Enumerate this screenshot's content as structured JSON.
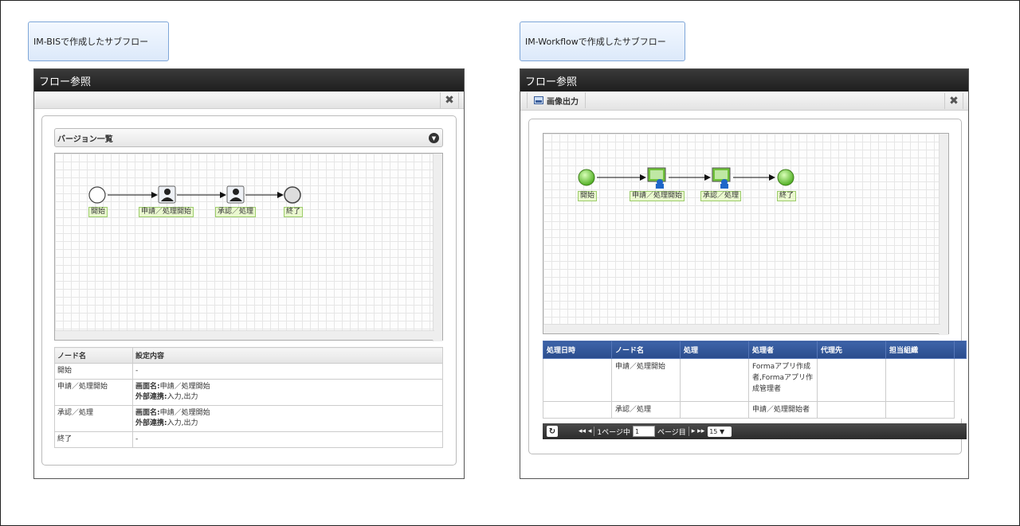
{
  "left": {
    "caption": "IM-BISで作成したサブフロー",
    "window_title": "フロー参照",
    "close_icon": "✖",
    "version_bar": "バージョン一覧",
    "toggle_icon": "▼",
    "nodes": [
      {
        "label": "開始",
        "icon": "start-circle"
      },
      {
        "label": "申請／処理開始",
        "icon": "user-task"
      },
      {
        "label": "承認／処理",
        "icon": "user-task"
      },
      {
        "label": "終了",
        "icon": "end-circle"
      }
    ],
    "table": {
      "headers": [
        "ノード名",
        "設定内容"
      ],
      "rows": [
        {
          "node": "開始",
          "line1_key": "",
          "line1_val": "-",
          "line2_key": "",
          "line2_val": ""
        },
        {
          "node": "申請／処理開始",
          "line1_key": "画面名:",
          "line1_val": "申請／処理開始",
          "line2_key": "外部連携:",
          "line2_val": "入力,出力"
        },
        {
          "node": "承認／処理",
          "line1_key": "画面名:",
          "line1_val": "申請／処理開始",
          "line2_key": "外部連携:",
          "line2_val": "入力,出力"
        },
        {
          "node": "終了",
          "line1_key": "",
          "line1_val": "-",
          "line2_key": "",
          "line2_val": ""
        }
      ]
    }
  },
  "right": {
    "caption": "IM-Workflowで作成したサブフロー",
    "window_title": "フロー参照",
    "image_output_button": "画像出力",
    "close_icon": "✖",
    "nodes": [
      {
        "label": "開始",
        "icon": "start-green"
      },
      {
        "label": "申請／処理開始",
        "icon": "monitor-user"
      },
      {
        "label": "承認／処理",
        "icon": "monitor-user"
      },
      {
        "label": "終了",
        "icon": "end-green"
      }
    ],
    "table": {
      "headers": [
        "処理日時",
        "ノード名",
        "処理",
        "処理者",
        "代理先",
        "担当組織"
      ],
      "rows": [
        [
          "",
          "申請／処理開始",
          "",
          "Formaアプリ作成者,Formaアプリ作成管理者",
          "",
          ""
        ],
        [
          "",
          "承認／処理",
          "",
          "申請／処理開始者",
          "",
          ""
        ]
      ]
    },
    "pager": {
      "refresh_icon": "↻",
      "first_prev": "◂◂ ◂",
      "page_prefix": "1ページ中",
      "page_value": "1",
      "page_suffix": "ページ目",
      "next_last": "▸ ▸▸",
      "per_page": "15 ▼"
    }
  },
  "colors": {
    "titlebar": "#2a2a2a",
    "caption_bg": "#dce9fa",
    "table_header_right": "#2f4f8f",
    "node_label_bg": "#eaf8cf",
    "green_node": "#6fcf3a"
  }
}
